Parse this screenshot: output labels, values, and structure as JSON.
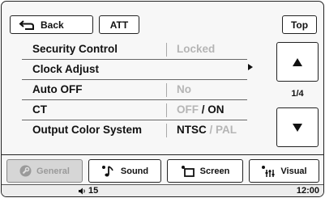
{
  "header": {
    "back_label": "Back",
    "att_label": "ATT",
    "top_label": "Top"
  },
  "menu": {
    "items": [
      {
        "label": "Security Control",
        "value": "Locked"
      },
      {
        "label": "Clock Adjust"
      },
      {
        "label": "Auto OFF",
        "value": "No"
      },
      {
        "label": "CT",
        "value_a": "OFF",
        "value_sep": " / ",
        "value_b": "ON"
      },
      {
        "label": "Output Color System",
        "value_a": "NTSC",
        "value_sep": " / ",
        "value_b": "PAL"
      }
    ]
  },
  "pager": {
    "page": "1/4"
  },
  "tabs": [
    {
      "label": "General",
      "icon": "wrench-icon",
      "state": "disabled"
    },
    {
      "label": "Sound",
      "icon": "music-note-icon"
    },
    {
      "label": "Screen",
      "icon": "screen-icon"
    },
    {
      "label": "Visual",
      "icon": "equalizer-icon"
    }
  ],
  "status": {
    "volume": "15",
    "time": "12:00"
  }
}
